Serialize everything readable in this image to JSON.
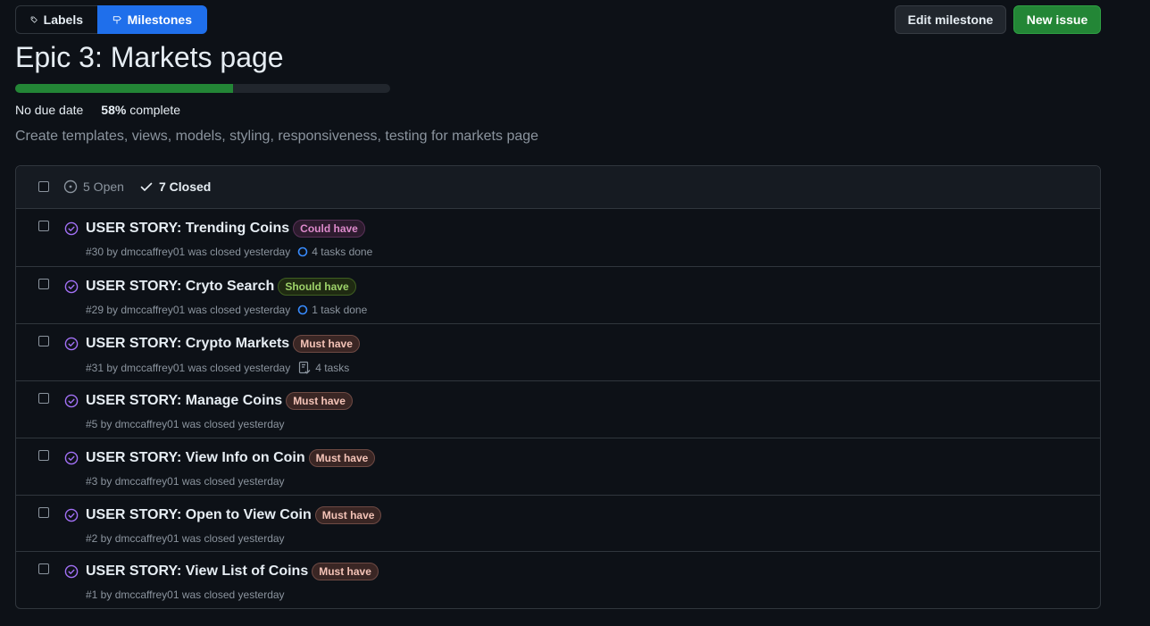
{
  "nav": {
    "labels": "Labels",
    "milestones": "Milestones"
  },
  "actions": {
    "edit": "Edit milestone",
    "new_issue": "New issue"
  },
  "milestone": {
    "title": "Epic 3: Markets page",
    "progress_fraction": 0.58,
    "due": "No due date",
    "percent": "58%",
    "complete_word": "complete",
    "description": "Create templates, views, models, styling, responsiveness, testing for markets page"
  },
  "filters": {
    "open": "5 Open",
    "closed": "7 Closed"
  },
  "colors": {
    "accent_blue": "#1f6feb",
    "green": "#238636",
    "closed_purple": "#a371f7",
    "could_have": {
      "text": "#dd8acb",
      "bg": "#2d1b2e",
      "border": "#5a3158"
    },
    "should_have": {
      "text": "#9ed36a",
      "bg": "#1f2a12",
      "border": "#3f5f21"
    },
    "must_have": {
      "text": "#f4c3b7",
      "bg": "#3a2624",
      "border": "#6e4a44"
    }
  },
  "issues": [
    {
      "title": "USER STORY: Trending Coins",
      "label": "Could have",
      "label_kind": "could_have",
      "meta": "#30 by dmccaffrey01 was closed yesterday",
      "task": "4 tasks done",
      "task_icon": "progress-circle-icon"
    },
    {
      "title": "USER STORY: Cryto Search",
      "label": "Should have",
      "label_kind": "should_have",
      "meta": "#29 by dmccaffrey01 was closed yesterday",
      "task": "1 task done",
      "task_icon": "progress-circle-icon"
    },
    {
      "title": "USER STORY: Crypto Markets",
      "label": "Must have",
      "label_kind": "must_have",
      "meta": "#31 by dmccaffrey01 was closed yesterday",
      "task": "4 tasks",
      "task_icon": "checklist-icon"
    },
    {
      "title": "USER STORY: Manage Coins",
      "label": "Must have",
      "label_kind": "must_have",
      "meta": "#5 by dmccaffrey01 was closed yesterday",
      "task": null
    },
    {
      "title": "USER STORY: View Info on Coin",
      "label": "Must have",
      "label_kind": "must_have",
      "meta": "#3 by dmccaffrey01 was closed yesterday",
      "task": null
    },
    {
      "title": "USER STORY: Open to View Coin",
      "label": "Must have",
      "label_kind": "must_have",
      "meta": "#2 by dmccaffrey01 was closed yesterday",
      "task": null
    },
    {
      "title": "USER STORY: View List of Coins",
      "label": "Must have",
      "label_kind": "must_have",
      "meta": "#1 by dmccaffrey01 was closed yesterday",
      "task": null
    }
  ]
}
